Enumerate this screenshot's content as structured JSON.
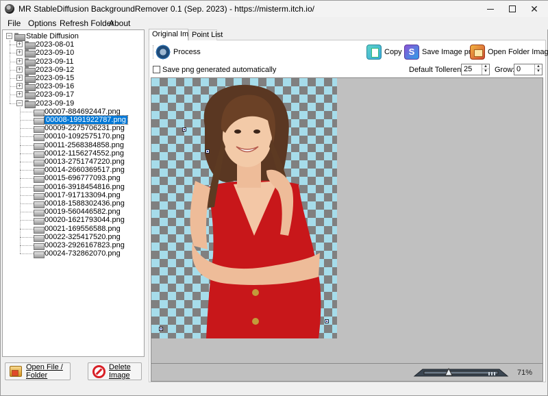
{
  "window": {
    "title": "MR StableDiffusion BackgroundRemover 0.1 (Sep. 2023) - https://misterm.itch.io/",
    "minimize": "—",
    "maximize": "☐",
    "close": "✕"
  },
  "menu": [
    {
      "label": "File"
    },
    {
      "label": "Options"
    },
    {
      "label": "Refresh Folder"
    },
    {
      "label": "About"
    }
  ],
  "tree": {
    "root": "Stable Diffusion",
    "collapsed_folders": [
      "2023-08-01",
      "2023-09-10",
      "2023-09-11",
      "2023-09-12",
      "2023-09-15",
      "2023-09-16",
      "2023-09-17"
    ],
    "expanded_folder": "2023-09-19",
    "files": [
      "00007-884692447.png",
      "00008-1991922787.png",
      "00009-2275706231.png",
      "00010-1092575170.png",
      "00011-2568384858.png",
      "00012-1156274552.png",
      "00013-2751747220.png",
      "00014-2660369517.png",
      "00015-696777093.png",
      "00016-3918454816.png",
      "00017-917133094.png",
      "00018-1588302436.png",
      "00019-560446582.png",
      "00020-1621793044.png",
      "00021-169556588.png",
      "00022-325417520.png",
      "00023-2926167823.png",
      "00024-732862070.png"
    ],
    "selected_file": "00008-1991922787.png"
  },
  "left_buttons": {
    "open": "Open File / Folder",
    "delete": "Delete Image"
  },
  "tabs": [
    {
      "label": "Original Image",
      "active": true
    },
    {
      "label": "Point List",
      "active": false
    }
  ],
  "toolbar": {
    "process": "Process",
    "copy": "Copy",
    "save_png": "Save Image png",
    "open_folder": "Open Folder Image"
  },
  "options": {
    "auto_png_label": "Save png generated automatically",
    "auto_png_checked": false,
    "tolerance_label": "Default Tollerence:",
    "tolerance_value": "25",
    "grow_label": "Grow:",
    "grow_value": "0"
  },
  "status": {
    "zoom": "71%",
    "zoom_level": 0.71
  },
  "colors": {
    "selection": "#0078d7",
    "checker_light": "#a6dcea",
    "checker_dark": "#808080",
    "dress": "#c8171a"
  }
}
